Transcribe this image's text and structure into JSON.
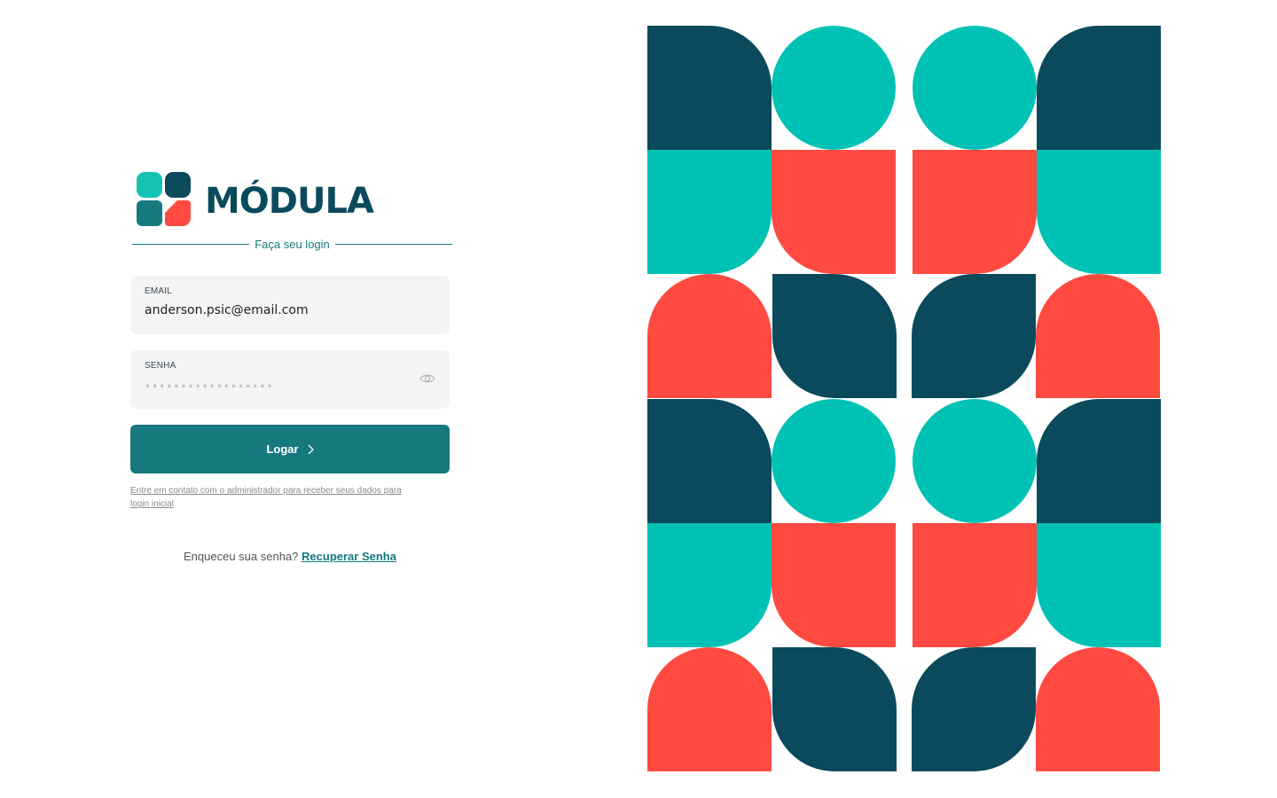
{
  "brand": {
    "name": "MÓDULA",
    "colors": {
      "navy": "#0b4a5c",
      "teal": "#00c2b4",
      "coral": "#ff4a41",
      "button": "#16797d"
    }
  },
  "login": {
    "heading": "Faça seu login",
    "email": {
      "label": "EMAIL",
      "value": "anderson.psic@email.com"
    },
    "password": {
      "label": "SENHA",
      "value": "••••••••••••••••••",
      "toggle_icon": "eye-icon"
    },
    "submit_label": "Logar",
    "submit_icon": "chevron-right-icon",
    "hint": "Entre em contato com o administrador para receber seus dados para login inicial",
    "forgot_prompt": "Enqueceu sua senha?",
    "forgot_link": "Recuperar Senha"
  }
}
